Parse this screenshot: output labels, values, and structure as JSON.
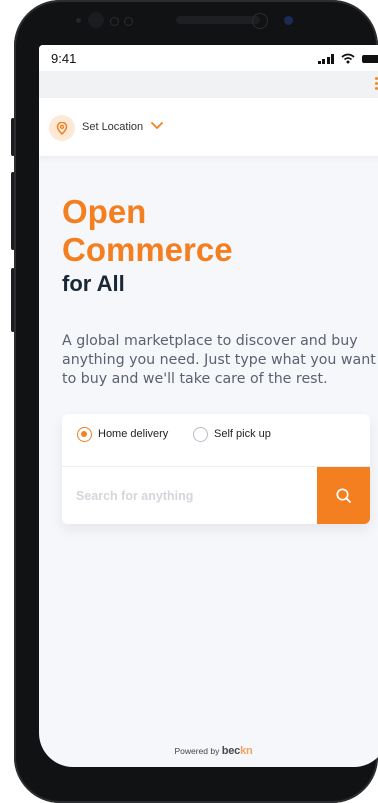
{
  "status_bar": {
    "time": "9:41"
  },
  "location": {
    "label": "Set Location"
  },
  "hero": {
    "line1": "Open",
    "line2": "Commerce",
    "line3": "for All"
  },
  "description": "A global marketplace to discover and buy anything you need. Just type what you want to buy and we'll take care of the rest.",
  "delivery_options": [
    {
      "label": "Home delivery",
      "selected": true
    },
    {
      "label": "Self pick up",
      "selected": false
    }
  ],
  "search": {
    "placeholder": "Search for anything",
    "value": ""
  },
  "footer": {
    "powered_by": "Powered by",
    "brand_main": "bec",
    "brand_accent": "kn"
  },
  "colors": {
    "accent": "#f47f20",
    "heading_dark": "#1c2736",
    "screen_bg": "#f5f7fb"
  },
  "icons": [
    "location-pin-icon",
    "chevron-down-icon",
    "kebab-menu-icon",
    "search-icon",
    "signal-icon",
    "wifi-icon",
    "battery-icon"
  ]
}
